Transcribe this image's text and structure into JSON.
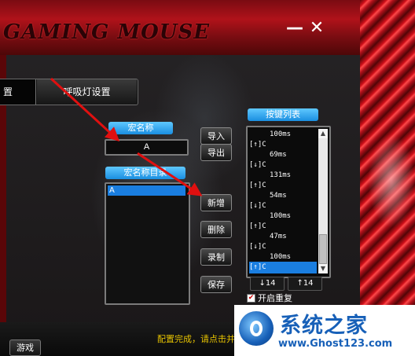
{
  "app": {
    "title_logo": "GAMING MOUSE",
    "minimize_glyph": "—",
    "close_glyph": "✕"
  },
  "tabs": {
    "partial_label": "置",
    "breathing_light": "呼吸灯设置"
  },
  "macro": {
    "name_label": "宏名称",
    "name_value": "A",
    "dir_label": "宏名称目录",
    "dir_items": [
      "A"
    ]
  },
  "buttons": {
    "import": "导入",
    "export": "导出",
    "add": "新增",
    "delete": "删除",
    "record": "录制",
    "save": "保存",
    "game": "游戏"
  },
  "key_list": {
    "label": "按键列表",
    "rows": [
      {
        "text": "100ms",
        "delay": true
      },
      {
        "text": "[↑]C",
        "delay": false
      },
      {
        "text": "69ms",
        "delay": true
      },
      {
        "text": "[↓]C",
        "delay": false
      },
      {
        "text": "131ms",
        "delay": true
      },
      {
        "text": "[↑]C",
        "delay": false
      },
      {
        "text": "54ms",
        "delay": true
      },
      {
        "text": "[↓]C",
        "delay": false
      },
      {
        "text": "100ms",
        "delay": true
      },
      {
        "text": "[↑]C",
        "delay": false
      },
      {
        "text": "47ms",
        "delay": true
      },
      {
        "text": "[↓]C",
        "delay": false
      },
      {
        "text": "100ms",
        "delay": true
      },
      {
        "text": "[↑]C",
        "delay": false,
        "selected": true
      }
    ],
    "down_count": "↓14",
    "up_count": "↑14",
    "repeat_label": "开启重复",
    "repeat_checked": true
  },
  "status": {
    "message": "配置完成，请点击并"
  },
  "watermark": {
    "main": "系统之家",
    "url": "www.Ghost123.com"
  },
  "colors": {
    "accent_blue": "#1a7ee0",
    "label_blue": "#5fc8ff",
    "brand_red": "#b0121a",
    "status_yellow": "#e6c200",
    "arrow_red": "#e01010"
  }
}
